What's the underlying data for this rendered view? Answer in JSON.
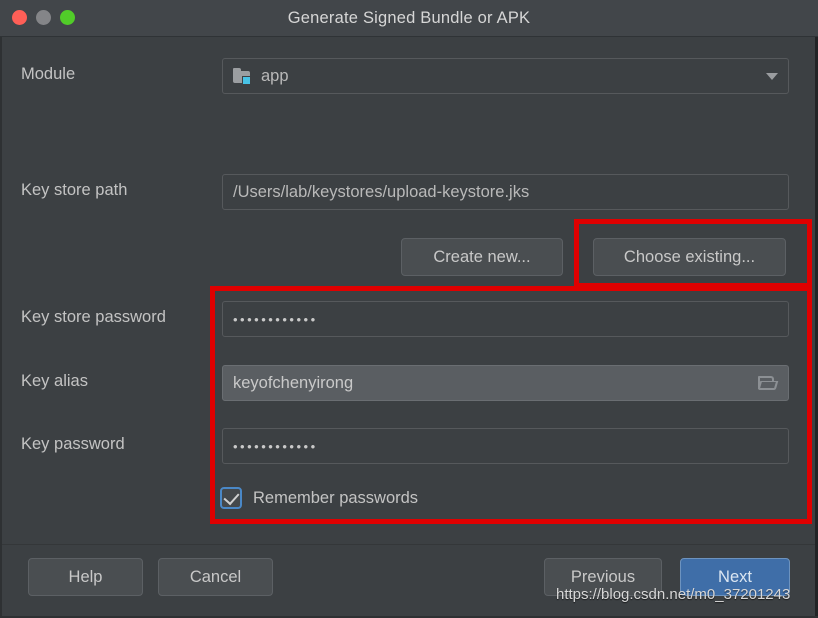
{
  "window": {
    "title": "Generate Signed Bundle or APK",
    "traffic_lights": [
      {
        "name": "close",
        "color": "#ff5f57"
      },
      {
        "name": "minimize",
        "color": "#848588"
      },
      {
        "name": "zoom",
        "color": "#51cc29"
      }
    ]
  },
  "form": {
    "module": {
      "label": "Module",
      "value": "app",
      "icon": "module-folder-icon",
      "dropdown_icon": "chevron-down-icon"
    },
    "key_store_path": {
      "label": "Key store path",
      "value": "/Users/lab/keystores/upload-keystore.jks"
    },
    "key_store_password": {
      "label": "Key store password",
      "value": "••••••••••••"
    },
    "key_alias": {
      "label": "Key alias",
      "value": "keyofchenyirong",
      "icon": "folder-open-icon"
    },
    "key_password": {
      "label": "Key password",
      "value": "••••••••••••"
    },
    "remember_passwords": {
      "label": "Remember passwords",
      "checked": true
    }
  },
  "keystore_buttons": {
    "create_new": "Create new...",
    "choose_existing": "Choose existing..."
  },
  "footer_buttons": {
    "help": "Help",
    "cancel": "Cancel",
    "previous": "Previous",
    "next": "Next"
  },
  "annotations": {
    "highlight_color": "#e00000",
    "boxes": [
      {
        "name": "choose-existing-highlight"
      },
      {
        "name": "credentials-section-highlight"
      }
    ]
  },
  "watermark": {
    "text": "https://blog.csdn.net/m0_37201243"
  }
}
